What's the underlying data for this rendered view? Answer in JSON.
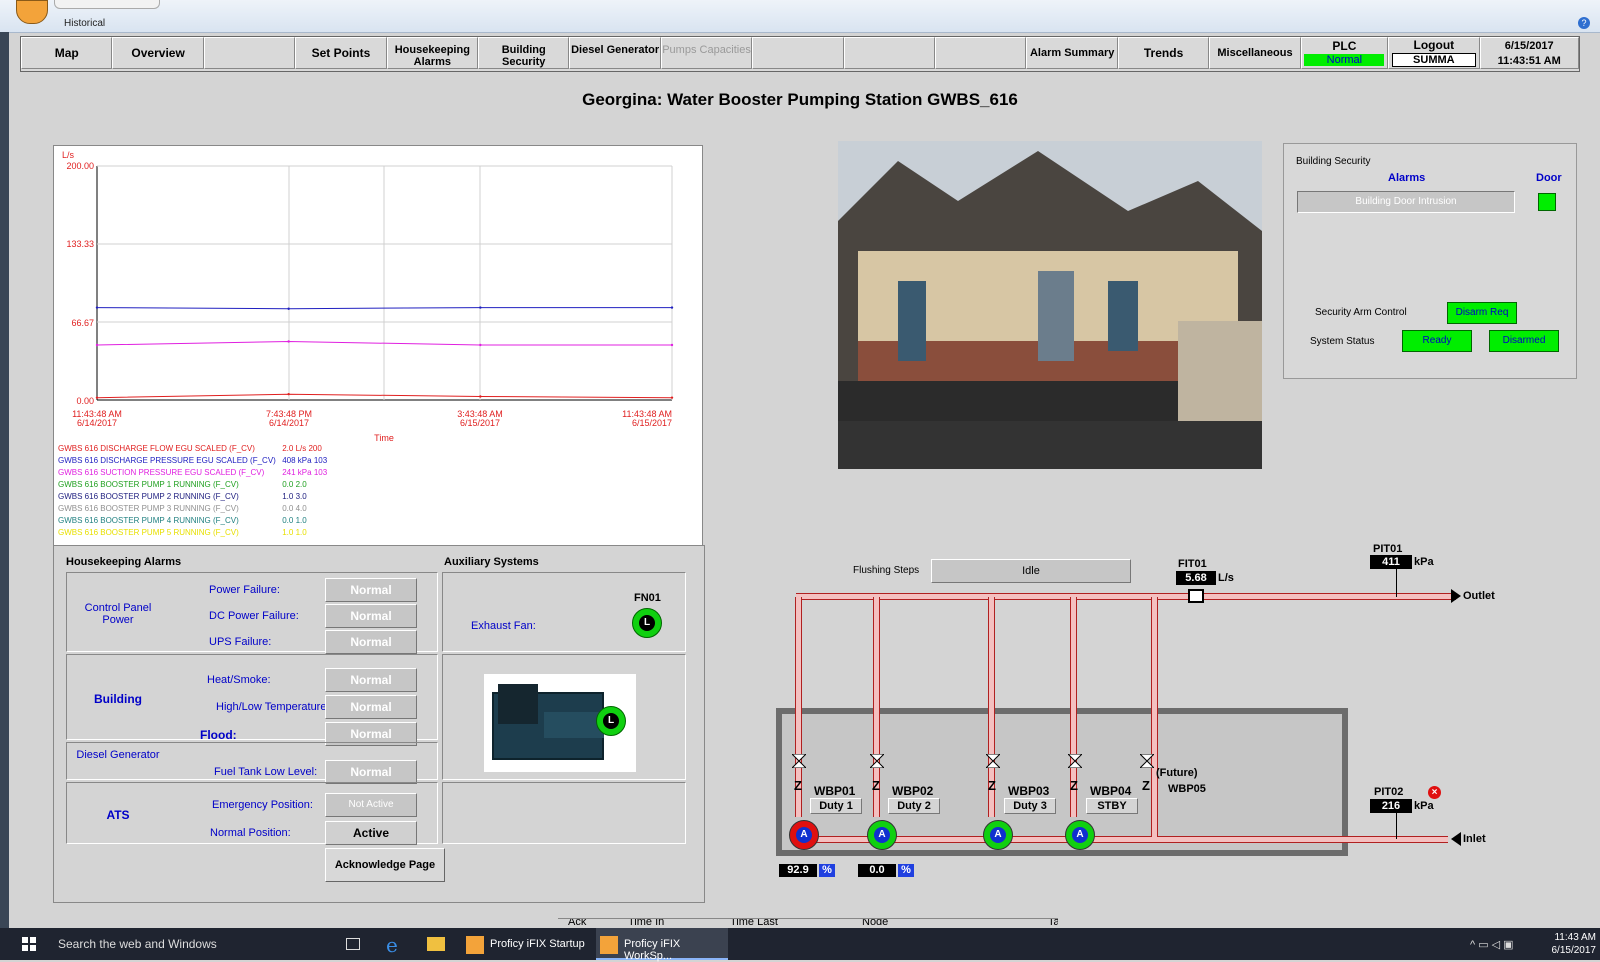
{
  "ribbon": {
    "tab": "Historical",
    "help": "?"
  },
  "nav": {
    "buttons": [
      {
        "label": "Map",
        "w": 92
      },
      {
        "label": "Overview",
        "w": 92
      },
      {
        "label": "",
        "w": 92
      },
      {
        "label": "Set Points",
        "w": 92
      },
      {
        "label": "Housekeeping Alarms",
        "w": 92
      },
      {
        "label": "Building Security",
        "w": 92
      },
      {
        "label": "Diesel Generator",
        "w": 92
      },
      {
        "label": "Pumps Capacities",
        "w": 92
      },
      {
        "label": "",
        "w": 92
      },
      {
        "label": "",
        "w": 92
      },
      {
        "label": "",
        "w": 92
      },
      {
        "label": "Alarm Summary",
        "w": 92
      },
      {
        "label": "Trends",
        "w": 92
      },
      {
        "label": "Miscellaneous",
        "w": 92
      }
    ],
    "plc_label": "PLC",
    "plc_status": "Normal",
    "logout_label": "Logout",
    "user": "SUMMA",
    "date": "6/15/2017",
    "time": "11:43:51 AM"
  },
  "page_title": "Georgina: Water Booster Pumping Station GWBS_616",
  "trend": {
    "y_unit": "L/s",
    "y_ticks": [
      "200.00",
      "133.33",
      "66.67",
      "0.00"
    ],
    "x_ticks": [
      {
        "t": "11:43:48 AM",
        "d": "6/14/2017"
      },
      {
        "t": "7:43:48 PM",
        "d": "6/14/2017"
      },
      {
        "t": "3:43:48 AM",
        "d": "6/15/2017"
      },
      {
        "t": "11:43:48 AM",
        "d": "6/15/2017"
      }
    ],
    "x_label": "Time",
    "legend": [
      {
        "name": "GWBS 616 DISCHARGE FLOW EGU SCALED (F_CV)",
        "value": "2.0  L/s  200",
        "color": "#e02020"
      },
      {
        "name": "GWBS 616 DISCHARGE PRESSURE EGU SCALED (F_CV)",
        "value": "408 kPa 103",
        "color": "#2020c0"
      },
      {
        "name": "GWBS 616 SUCTION PRESSURE EGU SCALED (F_CV)",
        "value": "241 kPa 103",
        "color": "#e020e0"
      },
      {
        "name": "GWBS 616 BOOSTER PUMP 1 RUNNING (F_CV)",
        "value": "0.0     2.0",
        "color": "#20a020"
      },
      {
        "name": "GWBS 616 BOOSTER PUMP 2 RUNNING (F_CV)",
        "value": "1.0     3.0",
        "color": "#202080"
      },
      {
        "name": "GWBS 616 BOOSTER PUMP 3 RUNNING (F_CV)",
        "value": "0.0     4.0",
        "color": "#909090"
      },
      {
        "name": "GWBS 616 BOOSTER PUMP 4 RUNNING (F_CV)",
        "value": "0.0     1.0",
        "color": "#208080"
      },
      {
        "name": "GWBS 616 BOOSTER PUMP 5 RUNNING (F_CV)",
        "value": "1.0     1.0",
        "color": "#e8e000"
      }
    ]
  },
  "housekeeping": {
    "title": "Housekeeping Alarms",
    "aux_title": "Auxiliary Systems",
    "control_panel": "Control Panel Power",
    "power_failure": "Power Failure:",
    "dc_power_failure": "DC Power Failure:",
    "ups_failure": "UPS Failure:",
    "building": "Building",
    "heat_smoke": "Heat/Smoke:",
    "high_low_temp": "High/Low Temperature:",
    "flood": "Flood:",
    "diesel_generator": "Diesel Generator",
    "fuel_tank": "Fuel Tank Low Level:",
    "ats": "ATS",
    "emergency_position": "Emergency Position:",
    "normal_position": "Normal Position:",
    "normal": "Normal",
    "not_active": "Not Active",
    "active": "Active",
    "fn01": "FN01",
    "exhaust_fan": "Exhaust Fan:",
    "fan_letter": "L",
    "gen_letter": "L",
    "acknowledge": "Acknowledge Page"
  },
  "security": {
    "title": "Building Security",
    "alarms": "Alarms",
    "door": "Door",
    "intrusion": "Building Door Intrusion",
    "arm_control": "Security Arm Control",
    "disarm_req": "Disarm Req",
    "system_status": "System Status",
    "ready": "Ready",
    "disarmed": "Disarmed"
  },
  "process": {
    "flushing_label": "Flushing Steps",
    "flushing_value": "Idle",
    "fit01": "FIT01",
    "fit01_value": "5.68",
    "fit01_unit": "L/s",
    "pit01": "PIT01",
    "pit01_value": "411",
    "pit02": "PIT02",
    "pit02_value": "216",
    "kpa": "kPa",
    "outlet": "Outlet",
    "inlet": "Inlet",
    "future": "(Future)",
    "pump_letter": "A",
    "pumps": [
      {
        "tag": "WBP01",
        "duty": "Duty 1",
        "color": "#e01010"
      },
      {
        "tag": "WBP02",
        "duty": "Duty 2",
        "color": "#10d010"
      },
      {
        "tag": "WBP03",
        "duty": "Duty 3",
        "color": "#10d010"
      },
      {
        "tag": "WBP04",
        "duty": "STBY",
        "color": "#10d010"
      }
    ],
    "wbp05": "WBP05",
    "speed1": "92.9",
    "speed2": "0.0",
    "pct": "%"
  },
  "alarm_strip": {
    "cols": [
      "Ack",
      "Time In",
      "Time Last",
      "Node",
      "Ta"
    ]
  },
  "taskbar": {
    "search": "Search the web and Windows",
    "app1": "Proficy iFIX Startup",
    "app2": "Proficy iFIX WorkSp...",
    "time": "11:43 AM",
    "date": "6/15/2017"
  },
  "colors": {
    "accent_green": "#00ee00",
    "label_blue": "#0000c8",
    "alarm_red": "#e01010"
  },
  "chart_data": {
    "type": "line",
    "xlabel": "Time",
    "ylabel": "L/s",
    "ylim": [
      0,
      200
    ],
    "x": [
      "6/14/2017 11:43:48 AM",
      "6/14/2017 7:43:48 PM",
      "6/15/2017 3:43:48 AM",
      "6/15/2017 11:43:48 AM"
    ],
    "series": [
      {
        "name": "GWBS 616 DISCHARGE FLOW EGU SCALED (F_CV)",
        "values": [
          2,
          5,
          3,
          2
        ]
      },
      {
        "name": "GWBS 616 DISCHARGE PRESSURE EGU SCALED (F_CV)",
        "values": [
          79,
          78,
          79,
          79
        ]
      },
      {
        "name": "GWBS 616 SUCTION PRESSURE EGU SCALED (F_CV)",
        "values": [
          47,
          50,
          47,
          47
        ]
      }
    ]
  }
}
